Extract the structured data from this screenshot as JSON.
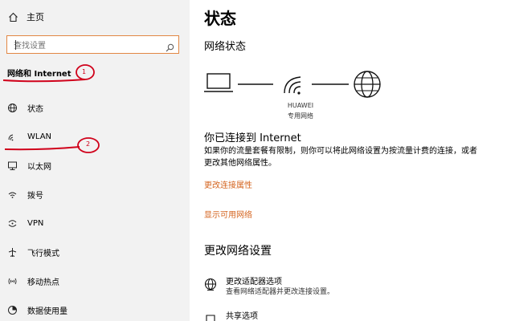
{
  "sidebar": {
    "home_label": "主页",
    "search_placeholder": "查找设置",
    "section_title": "网络和 Internet",
    "items": [
      {
        "label": "状态",
        "icon": "status-globe-icon"
      },
      {
        "label": "WLAN",
        "icon": "wifi-icon"
      },
      {
        "label": "以太网",
        "icon": "ethernet-icon"
      },
      {
        "label": "拨号",
        "icon": "dialup-icon"
      },
      {
        "label": "VPN",
        "icon": "vpn-icon"
      },
      {
        "label": "飞行模式",
        "icon": "airplane-icon"
      },
      {
        "label": "移动热点",
        "icon": "hotspot-icon"
      },
      {
        "label": "数据使用量",
        "icon": "data-usage-icon"
      }
    ]
  },
  "annotations": {
    "marker1": "1",
    "marker2": "2",
    "color": "#d0021b"
  },
  "main": {
    "title": "状态",
    "network_status_heading": "网络状态",
    "device_name": "HUAWEI",
    "device_type": "专用网络",
    "connected_title": "你已连接到 Internet",
    "connected_desc": "如果你的流量套餐有限制，则你可以将此网络设置为按流量计费的连接，或者更改其他网络属性。",
    "link_change_props": "更改连接属性",
    "link_show_networks": "显示可用网络",
    "change_settings_heading": "更改网络设置",
    "adapter_title": "更改适配器选项",
    "adapter_desc": "查看网络适配器并更改连接设置。",
    "sharing_title": "共享选项"
  },
  "colors": {
    "accent": "#d4641f",
    "sidebar_bg": "#f2f2f2"
  }
}
